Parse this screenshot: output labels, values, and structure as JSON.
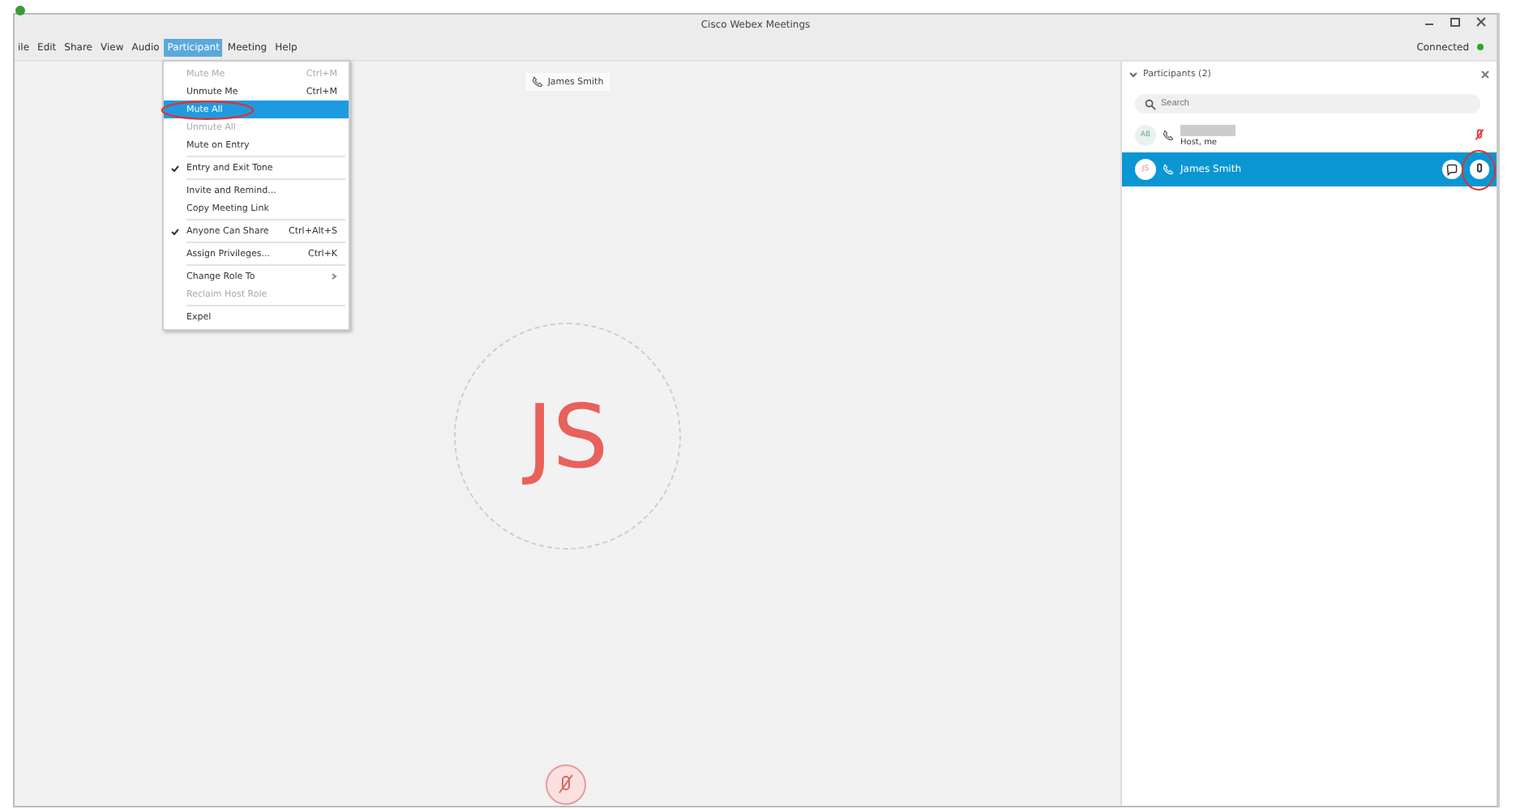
{
  "window": {
    "title": "Cisco Webex Meetings",
    "status": "Connected"
  },
  "menu_bar": [
    {
      "label": "ile",
      "selected": false
    },
    {
      "label": "Edit",
      "selected": false
    },
    {
      "label": "Share",
      "selected": false
    },
    {
      "label": "View",
      "selected": false
    },
    {
      "label": "Audio",
      "selected": false
    },
    {
      "label": "Participant",
      "selected": true
    },
    {
      "label": "Meeting",
      "selected": false
    },
    {
      "label": "Help",
      "selected": false
    }
  ],
  "menu": [
    {
      "kind": "item",
      "label": "Mute Me",
      "shortcut": "Ctrl+M",
      "disabled": true,
      "checked": false,
      "selected": false
    },
    {
      "kind": "item",
      "label": "Unmute Me",
      "shortcut": "Ctrl+M",
      "disabled": false,
      "checked": false,
      "selected": false
    },
    {
      "kind": "item",
      "label": "Mute All",
      "disabled": false,
      "checked": false,
      "selected": true
    },
    {
      "kind": "item",
      "label": "Unmute All",
      "disabled": true,
      "checked": false,
      "selected": false
    },
    {
      "kind": "item",
      "label": "Mute on Entry",
      "disabled": false,
      "checked": false,
      "selected": false
    },
    {
      "kind": "separator"
    },
    {
      "kind": "item",
      "label": "Entry and Exit Tone",
      "disabled": false,
      "checked": true,
      "selected": false
    },
    {
      "kind": "separator"
    },
    {
      "kind": "item",
      "label": "Invite and Remind...",
      "disabled": false,
      "checked": false,
      "selected": false
    },
    {
      "kind": "item",
      "label": "Copy Meeting Link",
      "disabled": false,
      "checked": false,
      "selected": false
    },
    {
      "kind": "separator"
    },
    {
      "kind": "item",
      "label": "Anyone Can Share",
      "shortcut": "Ctrl+Alt+S",
      "disabled": false,
      "checked": true,
      "selected": false
    },
    {
      "kind": "separator"
    },
    {
      "kind": "item",
      "label": "Assign Privileges...",
      "shortcut": "Ctrl+K",
      "disabled": false,
      "checked": false,
      "selected": false
    },
    {
      "kind": "separator"
    },
    {
      "kind": "submenu",
      "label": "Change Role To",
      "disabled": false,
      "checked": false,
      "selected": false
    },
    {
      "kind": "item",
      "label": "Reclaim Host Role",
      "disabled": true,
      "checked": false,
      "selected": false
    },
    {
      "kind": "separator"
    },
    {
      "kind": "item",
      "label": "Expel",
      "disabled": false,
      "checked": false,
      "selected": false
    }
  ],
  "stage": {
    "speaker_label": "James Smith",
    "avatar_initials": "JS",
    "muted": true
  },
  "participants_panel": {
    "title": "Participants (2)",
    "search": {
      "placeholder": "Search"
    },
    "participants": [
      {
        "initials": "AB",
        "subtitle": "Host, me",
        "selected": false,
        "muted": true
      },
      {
        "initials": "JS",
        "name": "James Smith",
        "selected": true,
        "muted": false
      }
    ]
  }
}
